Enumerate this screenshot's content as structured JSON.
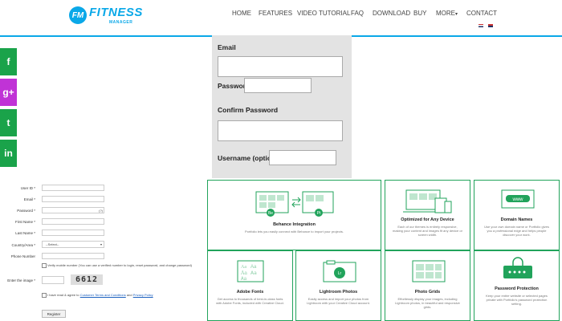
{
  "header": {
    "logo_badge": "FM",
    "logo_word": "FITNESS",
    "logo_sub": "MANAGER",
    "nav": [
      "HOME",
      "FEATURES",
      "VIDEO TUTORIAL",
      "FAQ",
      "DOWNLOAD",
      "BUY",
      "MORE",
      "CONTACT"
    ],
    "more_caret": "▾",
    "accent": "#0aa8e8"
  },
  "social": {
    "facebook": "f",
    "google_plus": "g+",
    "twitter": "t",
    "linkedin": "in",
    "colors": [
      "#1aa34a",
      "#c033d6",
      "#1aa34a",
      "#1aa34a"
    ]
  },
  "signup": {
    "email_label": "Email",
    "password_label": "Password",
    "confirm_label": "Confirm Password",
    "username_label": "Username (optional)"
  },
  "legacy_form": {
    "labels": [
      "User ID *",
      "Email *",
      "Password *",
      "First Name *",
      "Last Name *",
      "Country/Area *",
      "Phone Number",
      "Enter the image *"
    ],
    "password_hint": "(?)",
    "country_value": "--Select--",
    "notify_text": "Verify mobile number (You can use a verified number to login, reset password, and change password)",
    "captcha": "6612",
    "terms_text": "I have read & agree to",
    "terms_link1": "Customer Terms and Conditions",
    "terms_and": "and",
    "terms_link2": "Privacy Policy",
    "submit_label": "Register"
  },
  "features": [
    {
      "title": "Behance Integration",
      "desc": "Portfolio lets you easily connect with Behance to import your projects.",
      "badge1": "Be",
      "badge2": "Pt"
    },
    {
      "title": "Optimized for Any Device",
      "desc": "Each of our themes is entirely responsive, making your content and images fit any device or screen width."
    },
    {
      "title": "Domain Names",
      "desc": "Use your own domain name or Portfolio gives you a professional edge and helps people discover your work.",
      "badge": "www"
    },
    {
      "title": "Adobe Fonts",
      "desc": "Get access to thousands of best-in-class fonts with Adobe Fonts, included with Creative Cloud.",
      "glyph": "Aa"
    },
    {
      "title": "Lightroom Photos",
      "desc": "Easily access and import your photos from Lightroom with your Creative Cloud account.",
      "badge": "Lr"
    },
    {
      "title": "Photo Grids",
      "desc": "Effortlessly display your images, including Lightroom photos, in beautiful and responsive grids."
    },
    {
      "title": "Password Protection",
      "desc": "Keep your entire website or selected pages private with Portfolio's password protection setting."
    }
  ]
}
